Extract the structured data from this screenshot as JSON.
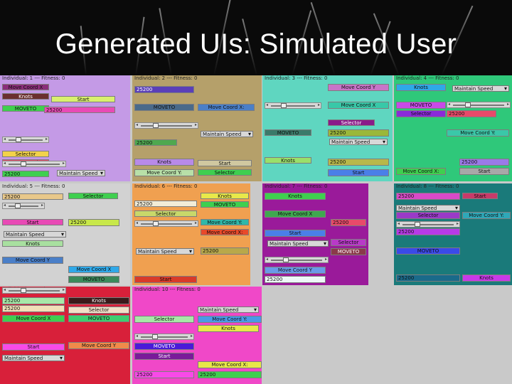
{
  "slide": {
    "title": "Generated UIs: Simulated User"
  },
  "panels": [
    {
      "title": "Individual: 1 --- Fitness: 0",
      "bg": "#c49ae6",
      "widgets": [
        {
          "t": "Move Coord X",
          "bg": "#8a2e7a"
        },
        {
          "t": "Knots",
          "bg": "#6a2f2f",
          "c": "#fff"
        },
        {
          "t": "Start",
          "bg": "#d9f06e"
        },
        {
          "t": "MOVETO",
          "bg": "#3fcf4f"
        },
        {
          "t": "25200",
          "bg": "#e84ab5"
        },
        {
          "t": "Selector",
          "bg": "#f2d24a"
        },
        {
          "t": "Move Coord X",
          "bg": "#e84a6a"
        },
        {
          "t": "25200",
          "bg": "#3fcf4f"
        },
        {
          "t": "Maintain Speed",
          "bg": "#d8d8d8"
        }
      ]
    },
    {
      "title": "Individual: 2 --- Fitness: 0",
      "bg": "#b5a06a",
      "widgets": [
        {
          "t": "25200",
          "bg": "#5a3fb8",
          "c": "#fff"
        },
        {
          "t": "MOVETO",
          "bg": "#4a6a8a"
        },
        {
          "t": "Move Coord X:",
          "bg": "#4a7fc8"
        },
        {
          "t": "Maintain Speed",
          "bg": "#d8d8d8"
        },
        {
          "t": "25200",
          "bg": "#4fa84f"
        },
        {
          "t": "Knots",
          "bg": "#b88ae8"
        },
        {
          "t": "Start",
          "bg": "#d0c8a0"
        },
        {
          "t": "Move Coord Y:",
          "bg": "#b8e0a8"
        },
        {
          "t": "Selector",
          "bg": "#3fcf4f"
        }
      ]
    },
    {
      "title": "Individual: 3 --- Fitness: 0",
      "bg": "#5fd6c0",
      "widgets": [
        {
          "t": "Move Coord Y",
          "bg": "#c874c8"
        },
        {
          "t": "Move Coord X",
          "bg": "#38c8a8"
        },
        {
          "t": "Selector",
          "bg": "#8a1a8a",
          "c": "#fff"
        },
        {
          "t": "MOVETO",
          "bg": "#3a7a6a"
        },
        {
          "t": "25200",
          "bg": "#9ab83a"
        },
        {
          "t": "Maintain Speed",
          "bg": "#d8d8d8"
        },
        {
          "t": "Knots",
          "bg": "#9ae06a"
        },
        {
          "t": "25200",
          "bg": "#b8b84a"
        },
        {
          "t": "Start",
          "bg": "#4a7fe8"
        }
      ]
    },
    {
      "title": "Individual: 4 --- Fitness: 0",
      "bg": "#2fc87a",
      "widgets": [
        {
          "t": "Knots",
          "bg": "#2fa8e8"
        },
        {
          "t": "Maintain Speed",
          "bg": "#d8d8d8"
        },
        {
          "t": "MOVETO",
          "bg": "#c84ae8"
        },
        {
          "t": "Selector",
          "bg": "#8a2ad8"
        },
        {
          "t": "25200",
          "bg": "#e84a6a"
        },
        {
          "t": "Move Coord Y:",
          "bg": "#3ac8a8"
        },
        {
          "t": "25200",
          "bg": "#9a7ae8"
        },
        {
          "t": "Move Coord X:",
          "bg": "#3fcf4f"
        },
        {
          "t": "Start",
          "bg": "#a8a8a8"
        }
      ]
    },
    {
      "title": "Individual: 5 --- Fitness: 0",
      "bg": "#d2d2d2",
      "widgets": [
        {
          "t": "25200",
          "bg": "#e8c88a"
        },
        {
          "t": "Selector",
          "bg": "#3fcf4f"
        },
        {
          "t": "Start",
          "bg": "#e84ab5"
        },
        {
          "t": "25200",
          "bg": "#c8e84a"
        },
        {
          "t": "Maintain Speed",
          "bg": "#d8d8d8"
        },
        {
          "t": "Knots",
          "bg": "#a8e0a0"
        },
        {
          "t": "Move Coord Y",
          "bg": "#4a7fc8"
        },
        {
          "t": "Move Coord X",
          "bg": "#2fa8e8"
        },
        {
          "t": "MOVETO",
          "bg": "#3a8a5a"
        }
      ]
    },
    {
      "title": "Individual: 6 --- Fitness: 0",
      "bg": "#f0a050",
      "widgets": [
        {
          "t": "25200",
          "bg": "#f2ecd8"
        },
        {
          "t": "Knots",
          "bg": "#e8e84a"
        },
        {
          "t": "Selector",
          "bg": "#c8d86a"
        },
        {
          "t": "MOVETO",
          "bg": "#3fcf4f"
        },
        {
          "t": "Move Coord Y:",
          "bg": "#2fb8a8"
        },
        {
          "t": "Move Coord X:",
          "bg": "#e84a2a"
        },
        {
          "t": "Maintain Speed",
          "bg": "#d8d8d8"
        },
        {
          "t": "25200",
          "bg": "#b8a84a"
        },
        {
          "t": "Start",
          "bg": "#d83a2a"
        }
      ]
    },
    {
      "title": "Individual: 7 --- Fitness: 0",
      "bg": "#9a1a9a",
      "widgets": [
        {
          "t": "Knots",
          "bg": "#3fcf4f"
        },
        {
          "t": "Move Coord X",
          "bg": "#3fa84f"
        },
        {
          "t": "25200",
          "bg": "#e84a6a"
        },
        {
          "t": "Start",
          "bg": "#4a7fe8"
        },
        {
          "t": "Maintain Speed",
          "bg": "#d8d8d8"
        },
        {
          "t": "Selector",
          "bg": "#b83ac8"
        },
        {
          "t": "MOVETO",
          "bg": "#8a3a4a",
          "c": "#fff"
        },
        {
          "t": "Move Coord Y",
          "bg": "#6a9ae8"
        },
        {
          "t": "25200",
          "bg": "#eef8f8"
        }
      ]
    },
    {
      "title": "Individual: 8 --- Fitness: 0",
      "bg": "#1a7a7a",
      "widgets": [
        {
          "t": "25200",
          "bg": "#d84ac8"
        },
        {
          "t": "Start",
          "bg": "#c83a6a"
        },
        {
          "t": "Maintain Speed",
          "bg": "#d8d8d8"
        },
        {
          "t": "Selector",
          "bg": "#9a3ac8"
        },
        {
          "t": "Move Coord Y:",
          "bg": "#2fa8b8"
        },
        {
          "t": "25200",
          "bg": "#b83ae8"
        },
        {
          "t": "MOVETO",
          "bg": "#3a4ae8"
        },
        {
          "t": "Knots",
          "bg": "#c83ae8"
        },
        {
          "t": "25200",
          "bg": "#1a6a8a"
        }
      ]
    },
    {
      "title": "Individual: 9 --- Fitness: 0",
      "bg": "#d8203a",
      "widgets": [
        {
          "t": "25200",
          "bg": "#a8e8a8"
        },
        {
          "t": "Knots",
          "bg": "#3a1a1a",
          "c": "#fff"
        },
        {
          "t": "25200",
          "bg": "#f2e0b8"
        },
        {
          "t": "Selector",
          "bg": "#f2e0c8"
        },
        {
          "t": "Move Coord X",
          "bg": "#3fcf4f"
        },
        {
          "t": "MOVETO",
          "bg": "#3fcf6f"
        },
        {
          "t": "Start",
          "bg": "#f84ae8"
        },
        {
          "t": "Move Coord Y",
          "bg": "#f08a4a"
        },
        {
          "t": "Maintain Speed",
          "bg": "#d8d8d8"
        }
      ]
    },
    {
      "title": "Individual: 10 --- Fitness: 0",
      "bg": "#f048c8",
      "widgets": [
        {
          "t": "Maintain Speed",
          "bg": "#d8d8d8"
        },
        {
          "t": "Selector",
          "bg": "#a8e8a8"
        },
        {
          "t": "Move Coord Y:",
          "bg": "#4a9ae8"
        },
        {
          "t": "Knots",
          "bg": "#e8e84a"
        },
        {
          "t": "MOVETO",
          "bg": "#4a1ad8",
          "c": "#fff"
        },
        {
          "t": "Start",
          "bg": "#7a1a9a",
          "c": "#fff"
        },
        {
          "t": "Move Coord X:",
          "bg": "#e8e84a"
        },
        {
          "t": "25200",
          "bg": "#f84ae8"
        },
        {
          "t": "25200",
          "bg": "#3fcf4f"
        }
      ]
    }
  ]
}
